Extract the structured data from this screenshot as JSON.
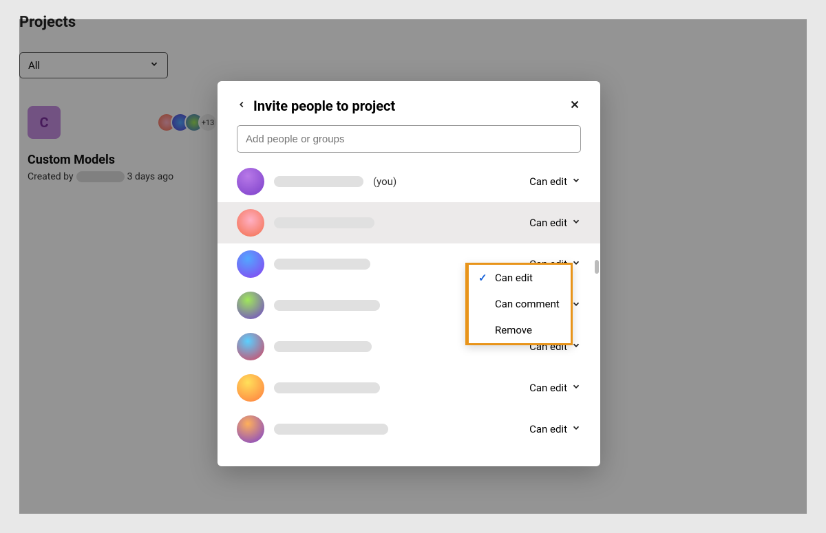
{
  "page": {
    "section_title": "Projects",
    "filter_selected": "All",
    "project_card": {
      "thumb_letter": "C",
      "name": "Custom Models",
      "created_prefix": "Created by",
      "created_suffix": "3 days ago",
      "overflow_count": "+13"
    }
  },
  "dialog": {
    "title": "Invite people to project",
    "search_placeholder": "Add people or groups",
    "you_suffix": "(you)",
    "permission_label": "Can edit",
    "people": [
      {
        "avatar_class": "av-a",
        "name_width": 130,
        "is_you": true,
        "highlighted": false
      },
      {
        "avatar_class": "av-b",
        "name_width": 146,
        "is_you": false,
        "highlighted": true
      },
      {
        "avatar_class": "av-c",
        "name_width": 140,
        "is_you": false,
        "highlighted": false
      },
      {
        "avatar_class": "av-d",
        "name_width": 154,
        "is_you": false,
        "highlighted": false
      },
      {
        "avatar_class": "av-e",
        "name_width": 142,
        "is_you": false,
        "highlighted": false
      },
      {
        "avatar_class": "av-f",
        "name_width": 154,
        "is_you": false,
        "highlighted": false
      },
      {
        "avatar_class": "av-g",
        "name_width": 166,
        "is_you": false,
        "highlighted": false
      }
    ]
  },
  "perm_menu": {
    "items": [
      {
        "label": "Can edit",
        "checked": true
      },
      {
        "label": "Can comment",
        "checked": false
      },
      {
        "label": "Remove",
        "checked": false
      }
    ]
  }
}
